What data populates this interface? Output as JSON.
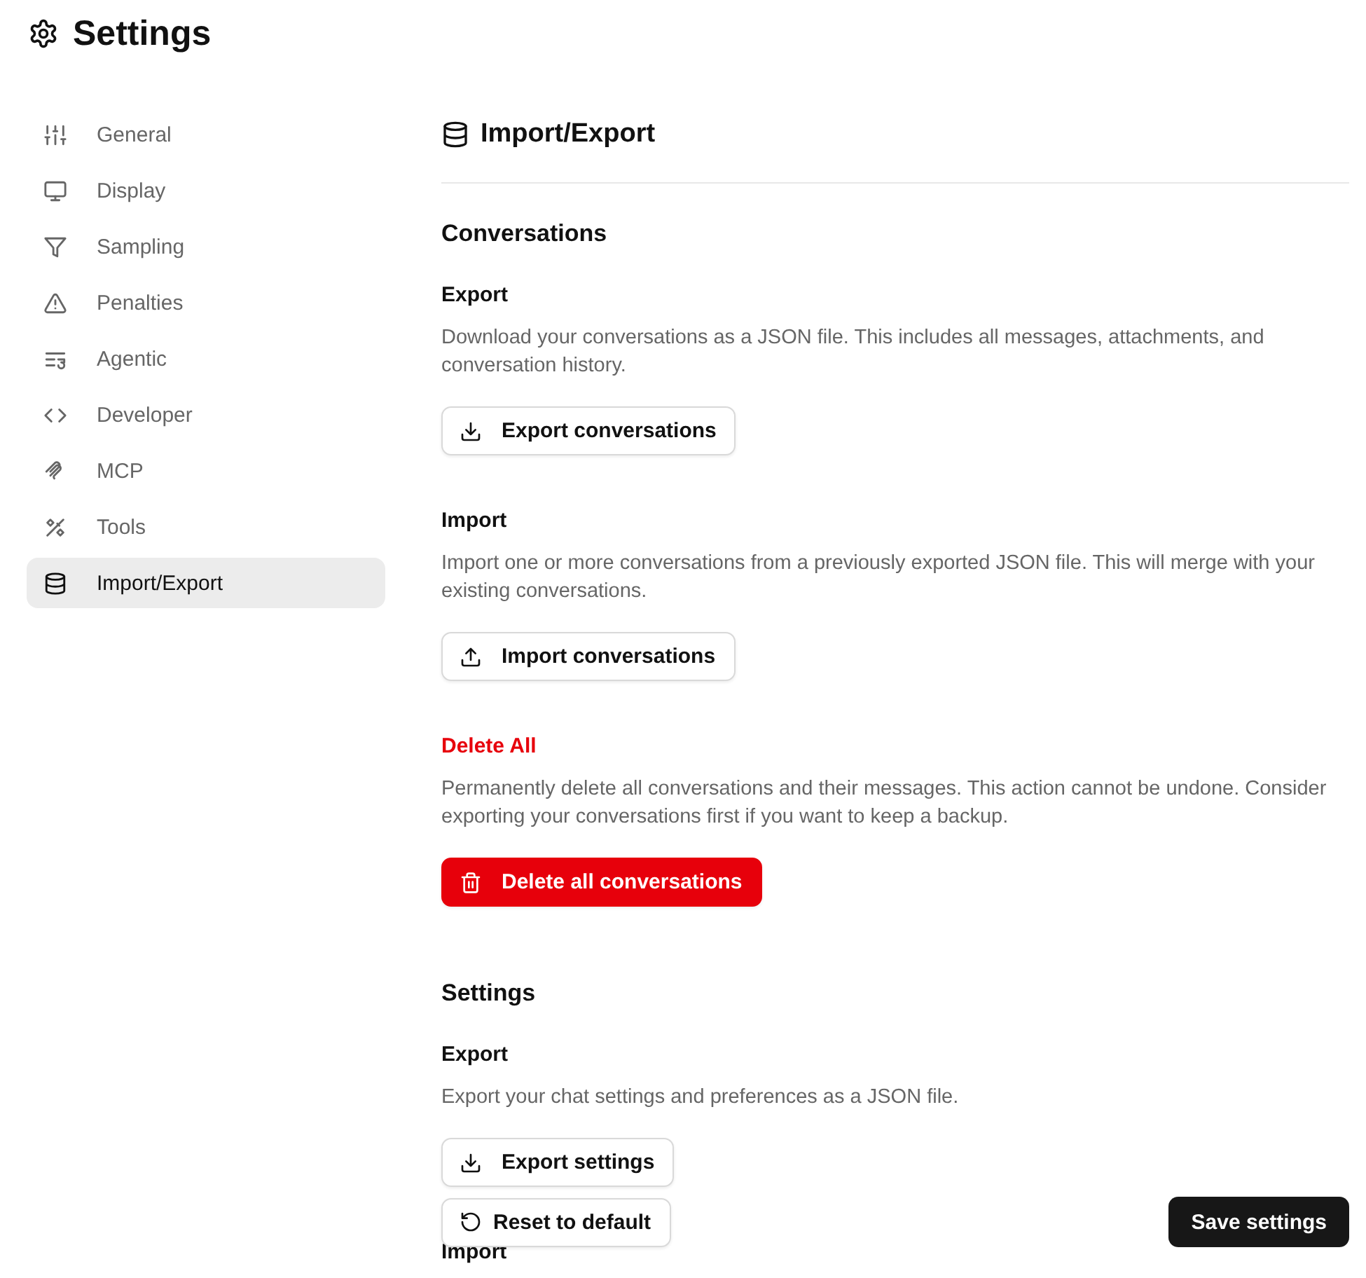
{
  "title": "Settings",
  "sidebar": {
    "items": [
      {
        "label": "General",
        "selected": false
      },
      {
        "label": "Display",
        "selected": false
      },
      {
        "label": "Sampling",
        "selected": false
      },
      {
        "label": "Penalties",
        "selected": false
      },
      {
        "label": "Agentic",
        "selected": false
      },
      {
        "label": "Developer",
        "selected": false
      },
      {
        "label": "MCP",
        "selected": false
      },
      {
        "label": "Tools",
        "selected": false
      },
      {
        "label": "Import/Export",
        "selected": true
      }
    ]
  },
  "panel": {
    "title": "Import/Export",
    "sections": [
      {
        "title": "Conversations",
        "groups": [
          {
            "kind": "normal",
            "heading": "Export",
            "description": "Download your conversations as a JSON file. This includes all messages, attachments, and conversation history.",
            "button": "Export conversations"
          },
          {
            "kind": "normal",
            "heading": "Import",
            "description": "Import one or more conversations from a previously exported JSON file. This will merge with your existing conversations.",
            "button": "Import conversations"
          },
          {
            "kind": "danger",
            "heading": "Delete All",
            "description": "Permanently delete all conversations and their messages. This action cannot be undone. Consider exporting your conversations first if you want to keep a backup.",
            "button": "Delete all conversations"
          }
        ]
      },
      {
        "title": "Settings",
        "groups": [
          {
            "kind": "normal",
            "heading": "Export",
            "description": "Export your chat settings and preferences as a JSON file.",
            "button": "Export settings"
          },
          {
            "kind": "normal",
            "heading": "Import"
          }
        ]
      }
    ]
  },
  "footer": {
    "reset_button": "Reset to default",
    "save_button": "Save settings"
  }
}
